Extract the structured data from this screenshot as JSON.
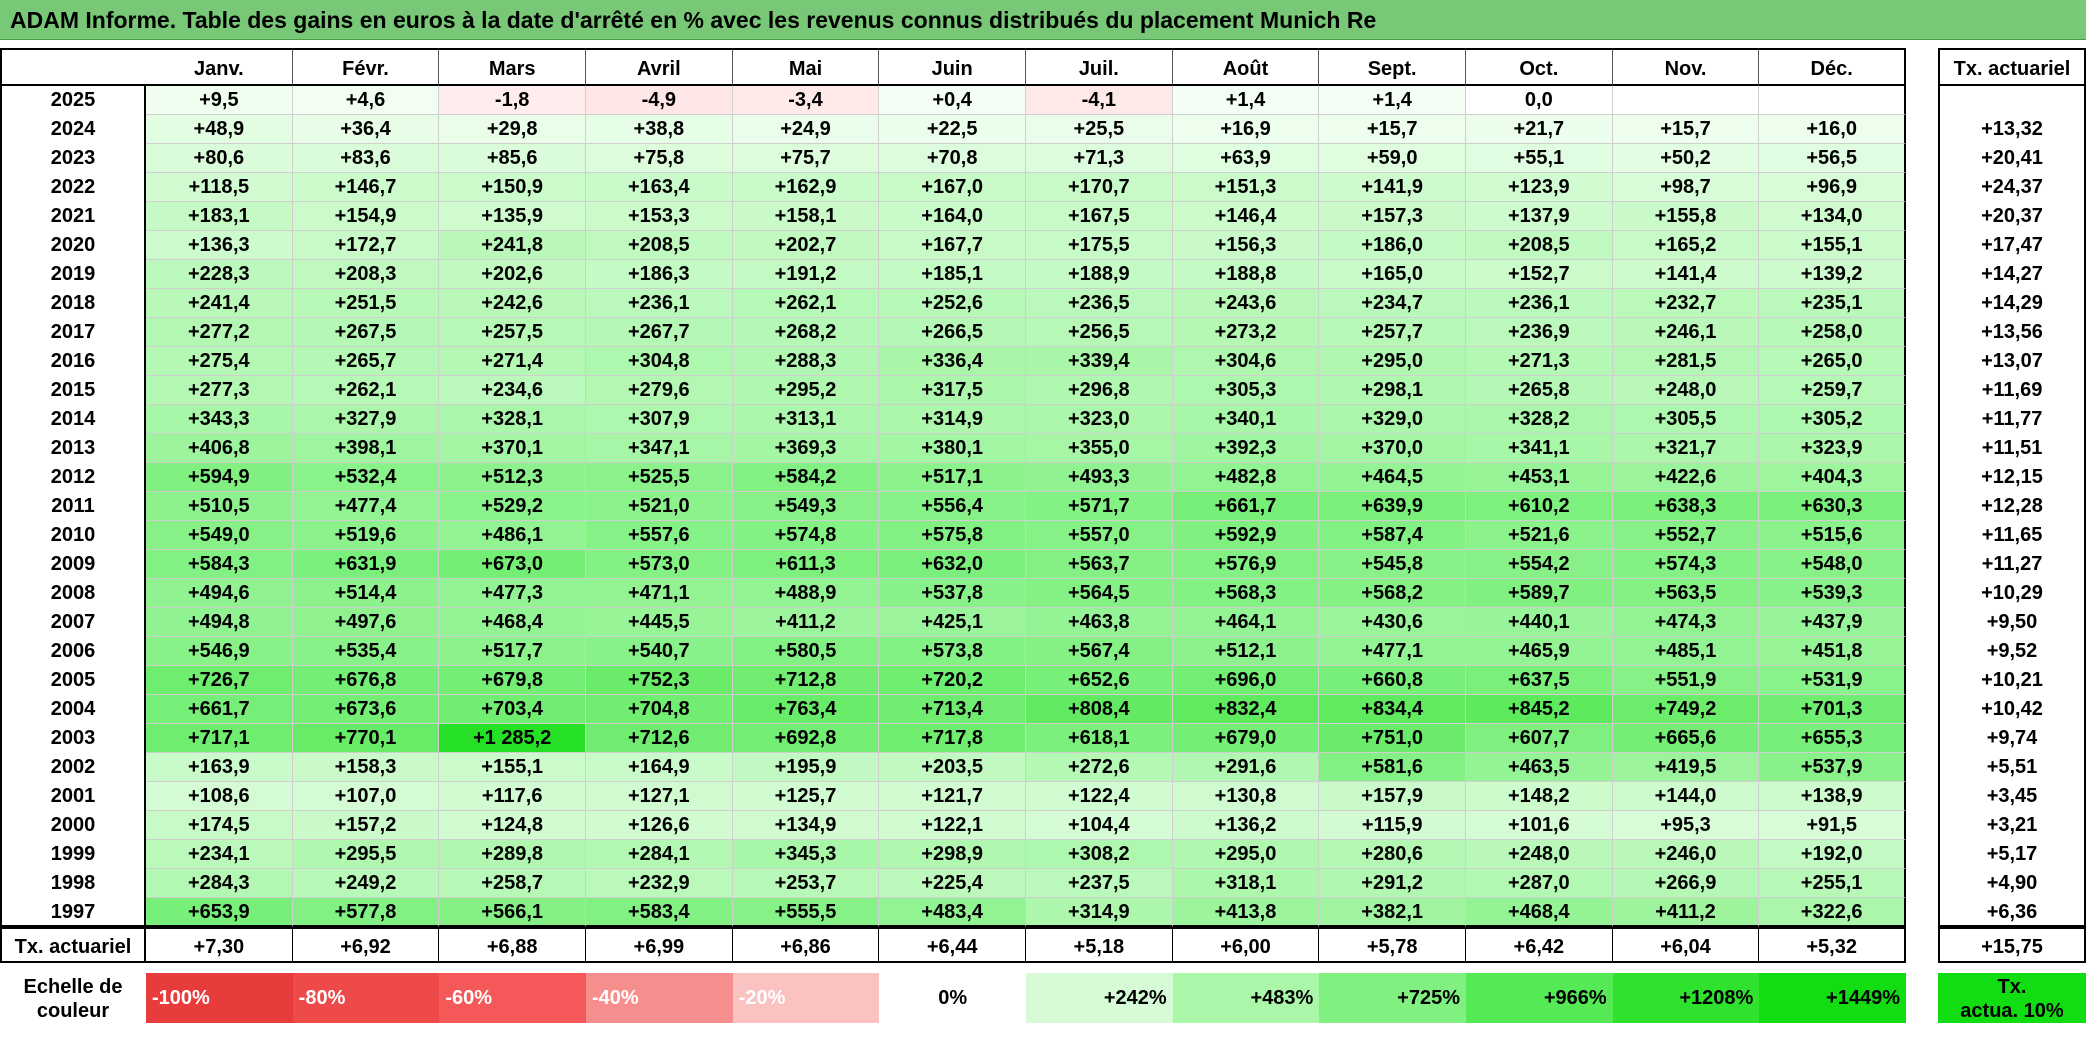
{
  "title": "ADAM Informe. Table des gains en euros à la date d'arrêté en % avec les revenus connus distribués du placement Munich Re",
  "months": [
    "Janv.",
    "Févr.",
    "Mars",
    "Avril",
    "Mai",
    "Juin",
    "Juil.",
    "Août",
    "Sept.",
    "Oct.",
    "Nov.",
    "Déc."
  ],
  "tx_header": "Tx. actuariel",
  "rows": [
    {
      "year": "2025",
      "values": [
        "+9,5",
        "+4,6",
        "-1,8",
        "-4,9",
        "-3,4",
        "+0,4",
        "-4,1",
        "+1,4",
        "+1,4",
        "0,0",
        "",
        ""
      ],
      "tx": ""
    },
    {
      "year": "2024",
      "values": [
        "+48,9",
        "+36,4",
        "+29,8",
        "+38,8",
        "+24,9",
        "+22,5",
        "+25,5",
        "+16,9",
        "+15,7",
        "+21,7",
        "+15,7",
        "+16,0"
      ],
      "tx": "+13,32"
    },
    {
      "year": "2023",
      "values": [
        "+80,6",
        "+83,6",
        "+85,6",
        "+75,8",
        "+75,7",
        "+70,8",
        "+71,3",
        "+63,9",
        "+59,0",
        "+55,1",
        "+50,2",
        "+56,5"
      ],
      "tx": "+20,41"
    },
    {
      "year": "2022",
      "values": [
        "+118,5",
        "+146,7",
        "+150,9",
        "+163,4",
        "+162,9",
        "+167,0",
        "+170,7",
        "+151,3",
        "+141,9",
        "+123,9",
        "+98,7",
        "+96,9"
      ],
      "tx": "+24,37"
    },
    {
      "year": "2021",
      "values": [
        "+183,1",
        "+154,9",
        "+135,9",
        "+153,3",
        "+158,1",
        "+164,0",
        "+167,5",
        "+146,4",
        "+157,3",
        "+137,9",
        "+155,8",
        "+134,0"
      ],
      "tx": "+20,37"
    },
    {
      "year": "2020",
      "values": [
        "+136,3",
        "+172,7",
        "+241,8",
        "+208,5",
        "+202,7",
        "+167,7",
        "+175,5",
        "+156,3",
        "+186,0",
        "+208,5",
        "+165,2",
        "+155,1"
      ],
      "tx": "+17,47"
    },
    {
      "year": "2019",
      "values": [
        "+228,3",
        "+208,3",
        "+202,6",
        "+186,3",
        "+191,2",
        "+185,1",
        "+188,9",
        "+188,8",
        "+165,0",
        "+152,7",
        "+141,4",
        "+139,2"
      ],
      "tx": "+14,27"
    },
    {
      "year": "2018",
      "values": [
        "+241,4",
        "+251,5",
        "+242,6",
        "+236,1",
        "+262,1",
        "+252,6",
        "+236,5",
        "+243,6",
        "+234,7",
        "+236,1",
        "+232,7",
        "+235,1"
      ],
      "tx": "+14,29"
    },
    {
      "year": "2017",
      "values": [
        "+277,2",
        "+267,5",
        "+257,5",
        "+267,7",
        "+268,2",
        "+266,5",
        "+256,5",
        "+273,2",
        "+257,7",
        "+236,9",
        "+246,1",
        "+258,0"
      ],
      "tx": "+13,56"
    },
    {
      "year": "2016",
      "values": [
        "+275,4",
        "+265,7",
        "+271,4",
        "+304,8",
        "+288,3",
        "+336,4",
        "+339,4",
        "+304,6",
        "+295,0",
        "+271,3",
        "+281,5",
        "+265,0"
      ],
      "tx": "+13,07"
    },
    {
      "year": "2015",
      "values": [
        "+277,3",
        "+262,1",
        "+234,6",
        "+279,6",
        "+295,2",
        "+317,5",
        "+296,8",
        "+305,3",
        "+298,1",
        "+265,8",
        "+248,0",
        "+259,7"
      ],
      "tx": "+11,69"
    },
    {
      "year": "2014",
      "values": [
        "+343,3",
        "+327,9",
        "+328,1",
        "+307,9",
        "+313,1",
        "+314,9",
        "+323,0",
        "+340,1",
        "+329,0",
        "+328,2",
        "+305,5",
        "+305,2"
      ],
      "tx": "+11,77"
    },
    {
      "year": "2013",
      "values": [
        "+406,8",
        "+398,1",
        "+370,1",
        "+347,1",
        "+369,3",
        "+380,1",
        "+355,0",
        "+392,3",
        "+370,0",
        "+341,1",
        "+321,7",
        "+323,9"
      ],
      "tx": "+11,51"
    },
    {
      "year": "2012",
      "values": [
        "+594,9",
        "+532,4",
        "+512,3",
        "+525,5",
        "+584,2",
        "+517,1",
        "+493,3",
        "+482,8",
        "+464,5",
        "+453,1",
        "+422,6",
        "+404,3"
      ],
      "tx": "+12,15"
    },
    {
      "year": "2011",
      "values": [
        "+510,5",
        "+477,4",
        "+529,2",
        "+521,0",
        "+549,3",
        "+556,4",
        "+571,7",
        "+661,7",
        "+639,9",
        "+610,2",
        "+638,3",
        "+630,3"
      ],
      "tx": "+12,28"
    },
    {
      "year": "2010",
      "values": [
        "+549,0",
        "+519,6",
        "+486,1",
        "+557,6",
        "+574,8",
        "+575,8",
        "+557,0",
        "+592,9",
        "+587,4",
        "+521,6",
        "+552,7",
        "+515,6"
      ],
      "tx": "+11,65"
    },
    {
      "year": "2009",
      "values": [
        "+584,3",
        "+631,9",
        "+673,0",
        "+573,0",
        "+611,3",
        "+632,0",
        "+563,7",
        "+576,9",
        "+545,8",
        "+554,2",
        "+574,3",
        "+548,0"
      ],
      "tx": "+11,27"
    },
    {
      "year": "2008",
      "values": [
        "+494,6",
        "+514,4",
        "+477,3",
        "+471,1",
        "+488,9",
        "+537,8",
        "+564,5",
        "+568,3",
        "+568,2",
        "+589,7",
        "+563,5",
        "+539,3"
      ],
      "tx": "+10,29"
    },
    {
      "year": "2007",
      "values": [
        "+494,8",
        "+497,6",
        "+468,4",
        "+445,5",
        "+411,2",
        "+425,1",
        "+463,8",
        "+464,1",
        "+430,6",
        "+440,1",
        "+474,3",
        "+437,9"
      ],
      "tx": "+9,50"
    },
    {
      "year": "2006",
      "values": [
        "+546,9",
        "+535,4",
        "+517,7",
        "+540,7",
        "+580,5",
        "+573,8",
        "+567,4",
        "+512,1",
        "+477,1",
        "+465,9",
        "+485,1",
        "+451,8"
      ],
      "tx": "+9,52"
    },
    {
      "year": "2005",
      "values": [
        "+726,7",
        "+676,8",
        "+679,8",
        "+752,3",
        "+712,8",
        "+720,2",
        "+652,6",
        "+696,0",
        "+660,8",
        "+637,5",
        "+551,9",
        "+531,9"
      ],
      "tx": "+10,21"
    },
    {
      "year": "2004",
      "values": [
        "+661,7",
        "+673,6",
        "+703,4",
        "+704,8",
        "+763,4",
        "+713,4",
        "+808,4",
        "+832,4",
        "+834,4",
        "+845,2",
        "+749,2",
        "+701,3"
      ],
      "tx": "+10,42"
    },
    {
      "year": "2003",
      "values": [
        "+717,1",
        "+770,1",
        "+1 285,2",
        "+712,6",
        "+692,8",
        "+717,8",
        "+618,1",
        "+679,0",
        "+751,0",
        "+607,7",
        "+665,6",
        "+655,3"
      ],
      "tx": "+9,74"
    },
    {
      "year": "2002",
      "values": [
        "+163,9",
        "+158,3",
        "+155,1",
        "+164,9",
        "+195,9",
        "+203,5",
        "+272,6",
        "+291,6",
        "+581,6",
        "+463,5",
        "+419,5",
        "+537,9"
      ],
      "tx": "+5,51"
    },
    {
      "year": "2001",
      "values": [
        "+108,6",
        "+107,0",
        "+117,6",
        "+127,1",
        "+125,7",
        "+121,7",
        "+122,4",
        "+130,8",
        "+157,9",
        "+148,2",
        "+144,0",
        "+138,9"
      ],
      "tx": "+3,45"
    },
    {
      "year": "2000",
      "values": [
        "+174,5",
        "+157,2",
        "+124,8",
        "+126,6",
        "+134,9",
        "+122,1",
        "+104,4",
        "+136,2",
        "+115,9",
        "+101,6",
        "+95,3",
        "+91,5"
      ],
      "tx": "+3,21"
    },
    {
      "year": "1999",
      "values": [
        "+234,1",
        "+295,5",
        "+289,8",
        "+284,1",
        "+345,3",
        "+298,9",
        "+308,2",
        "+295,0",
        "+280,6",
        "+248,0",
        "+246,0",
        "+192,0"
      ],
      "tx": "+5,17"
    },
    {
      "year": "1998",
      "values": [
        "+284,3",
        "+249,2",
        "+258,7",
        "+232,9",
        "+253,7",
        "+225,4",
        "+237,5",
        "+318,1",
        "+291,2",
        "+287,0",
        "+266,9",
        "+255,1"
      ],
      "tx": "+4,90"
    },
    {
      "year": "1997",
      "values": [
        "+653,9",
        "+577,8",
        "+566,1",
        "+583,4",
        "+555,5",
        "+483,4",
        "+314,9",
        "+413,8",
        "+382,1",
        "+468,4",
        "+411,2",
        "+322,6"
      ],
      "tx": "+6,36"
    }
  ],
  "footer": {
    "label": "Tx. actuariel",
    "values": [
      "+7,30",
      "+6,92",
      "+6,88",
      "+6,99",
      "+6,86",
      "+6,44",
      "+5,18",
      "+6,00",
      "+5,78",
      "+6,42",
      "+6,04",
      "+5,32"
    ],
    "tx": "+15,75"
  },
  "scale": {
    "label_line1": "Echelle de",
    "label_line2": "couleur",
    "items": [
      {
        "text": "-100%",
        "color": "#e83c3c",
        "kind": "neg"
      },
      {
        "text": "-80%",
        "color": "#ee4a4a",
        "kind": "neg"
      },
      {
        "text": "-60%",
        "color": "#f45858",
        "kind": "neg"
      },
      {
        "text": "-40%",
        "color": "#f78e8e",
        "kind": "neg"
      },
      {
        "text": "-20%",
        "color": "#fbc2c2",
        "kind": "neg"
      },
      {
        "text": "0%",
        "color": "#ffffff",
        "kind": "zero"
      },
      {
        "text": "+242%",
        "color": "#d6fbd6",
        "kind": "pos"
      },
      {
        "text": "+483%",
        "color": "#aaf7aa",
        "kind": "pos"
      },
      {
        "text": "+725%",
        "color": "#80f180",
        "kind": "pos"
      },
      {
        "text": "+966%",
        "color": "#55ea55",
        "kind": "pos"
      },
      {
        "text": "+1208%",
        "color": "#2ee22e",
        "kind": "pos"
      },
      {
        "text": "+1449%",
        "color": "#12dc12",
        "kind": "pos"
      }
    ],
    "tx_line1": "Tx.",
    "tx_line2": "actua. 10%",
    "tx_color": "#12dc12"
  }
}
